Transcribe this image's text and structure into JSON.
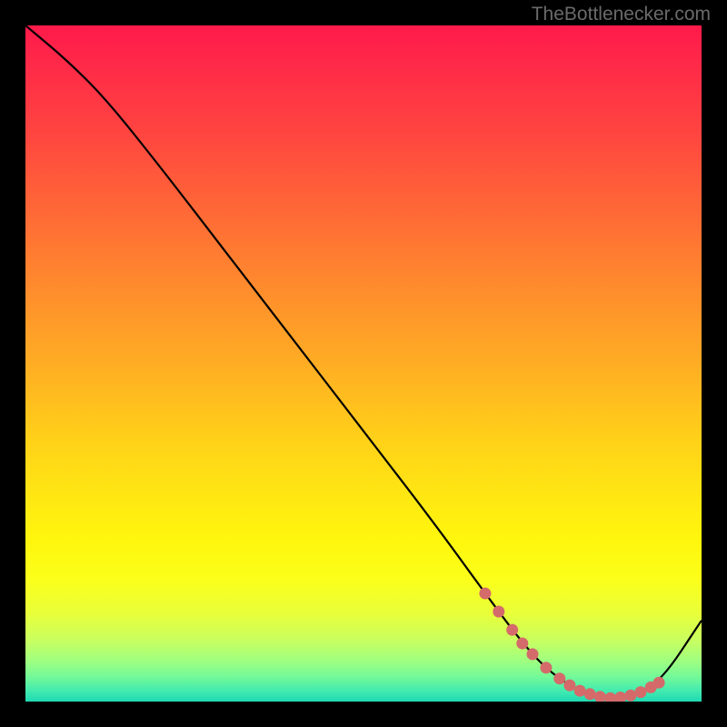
{
  "watermark": "TheBottlenecker.com",
  "chart_data": {
    "type": "line",
    "title": "",
    "xlabel": "",
    "ylabel": "",
    "xlim": [
      0,
      100
    ],
    "ylim": [
      0,
      100
    ],
    "grid": false,
    "legend": false,
    "series": [
      {
        "name": "bottleneck-curve",
        "x": [
          0,
          6,
          12,
          20,
          30,
          40,
          50,
          60,
          68,
          74,
          78,
          82,
          86,
          90,
          94,
          100
        ],
        "y": [
          100,
          95,
          89,
          79,
          66,
          53,
          40,
          27,
          16,
          8,
          4,
          1.5,
          0.5,
          1,
          3,
          12
        ],
        "color": "#000000"
      }
    ],
    "markers": [
      {
        "name": "highlight-band",
        "color": "#d46a6a",
        "points": [
          {
            "x": 68.0,
            "y": 16.0
          },
          {
            "x": 70.0,
            "y": 13.3
          },
          {
            "x": 72.0,
            "y": 10.6
          },
          {
            "x": 73.5,
            "y": 8.6
          },
          {
            "x": 75.0,
            "y": 7.0
          },
          {
            "x": 77.0,
            "y": 5.0
          },
          {
            "x": 79.0,
            "y": 3.4
          },
          {
            "x": 80.5,
            "y": 2.4
          },
          {
            "x": 82.0,
            "y": 1.6
          },
          {
            "x": 83.5,
            "y": 1.1
          },
          {
            "x": 85.0,
            "y": 0.7
          },
          {
            "x": 86.5,
            "y": 0.5
          },
          {
            "x": 88.0,
            "y": 0.6
          },
          {
            "x": 89.5,
            "y": 0.9
          },
          {
            "x": 91.0,
            "y": 1.4
          },
          {
            "x": 92.5,
            "y": 2.1
          },
          {
            "x": 93.7,
            "y": 2.8
          }
        ]
      }
    ],
    "background_gradient": {
      "top": "#ff1a4a",
      "mid": "#ffe812",
      "bottom": "#1fd8b2"
    }
  }
}
